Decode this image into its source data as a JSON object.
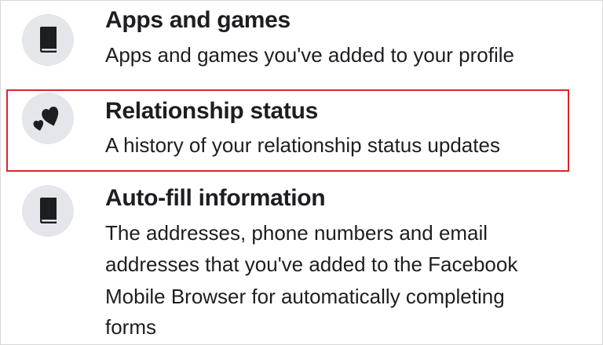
{
  "items": [
    {
      "icon": "book-icon",
      "title": "Apps and games",
      "description_lines": [
        "Apps and games you've added to your profile"
      ]
    },
    {
      "icon": "hearts-icon",
      "title": "Relationship status",
      "description_lines": [
        "A history of your relationship status updates"
      ],
      "highlighted": true
    },
    {
      "icon": "book-icon",
      "title": "Auto-fill information",
      "description_lines": [
        "The addresses, phone numbers and email",
        "addresses that you've added to the Facebook",
        "Mobile Browser for automatically completing",
        "forms"
      ]
    }
  ],
  "colors": {
    "icon_background": "#e4e6eb",
    "highlight_border": "#d9262a",
    "text": "#1c1e21"
  }
}
